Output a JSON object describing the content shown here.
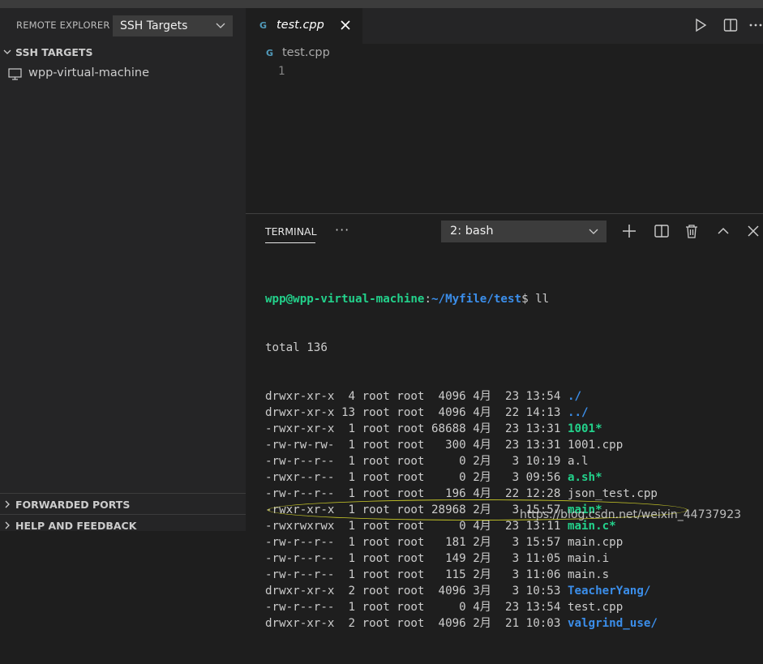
{
  "sidebar": {
    "header_label": "REMOTE EXPLORER",
    "selector_value": "SSH Targets",
    "sections": {
      "ssh_targets": "SSH TARGETS",
      "forwarded_ports": "FORWARDED PORTS",
      "help_feedback": "HELP AND FEEDBACK"
    },
    "targets": [
      "wpp-virtual-machine"
    ]
  },
  "editor": {
    "tab_label": "test.cpp",
    "breadcrumb": "test.cpp",
    "line_numbers": [
      "1"
    ],
    "file_icon": "cpp-file-icon"
  },
  "panel": {
    "tab_label": "TERMINAL",
    "more": "···",
    "terminal_select": "2: bash"
  },
  "terminal": {
    "prompt_user": "wpp@wpp-virtual-machine",
    "prompt_sep": ":",
    "prompt_path": "~/Myfile/test",
    "prompt_cmd": "$ ll",
    "total": "total 136",
    "rows": [
      {
        "meta": "drwxr-xr-x  4 root root  4096 4月  23 13:54 ",
        "name": "./",
        "kind": "dir"
      },
      {
        "meta": "drwxr-xr-x 13 root root  4096 4月  22 14:13 ",
        "name": "../",
        "kind": "dir"
      },
      {
        "meta": "-rwxr-xr-x  1 root root 68688 4月  23 13:31 ",
        "name": "1001*",
        "kind": "exe"
      },
      {
        "meta": "-rw-rw-rw-  1 root root   300 4月  23 13:31 ",
        "name": "1001.cpp",
        "kind": "file"
      },
      {
        "meta": "-rw-r--r--  1 root root     0 2月   3 10:19 ",
        "name": "a.l",
        "kind": "file"
      },
      {
        "meta": "-rwxr--r--  1 root root     0 2月   3 09:56 ",
        "name": "a.sh*",
        "kind": "exe"
      },
      {
        "meta": "-rw-r--r--  1 root root   196 4月  22 12:28 ",
        "name": "json_test.cpp",
        "kind": "file"
      },
      {
        "meta": "-rwxr-xr-x  1 root root 28968 2月   3 15:57 ",
        "name": "main*",
        "kind": "exe"
      },
      {
        "meta": "-rwxrwxrwx  1 root root     0 4月  23 13:11 ",
        "name": "main.c*",
        "kind": "exe"
      },
      {
        "meta": "-rw-r--r--  1 root root   181 2月   3 15:57 ",
        "name": "main.cpp",
        "kind": "file"
      },
      {
        "meta": "-rw-r--r--  1 root root   149 2月   3 11:05 ",
        "name": "main.i",
        "kind": "file"
      },
      {
        "meta": "-rw-r--r--  1 root root   115 2月   3 11:06 ",
        "name": "main.s",
        "kind": "file"
      },
      {
        "meta": "drwxr-xr-x  2 root root  4096 3月   3 10:53 ",
        "name": "TeacherYang/",
        "kind": "dir"
      },
      {
        "meta": "-rw-r--r--  1 root root     0 4月  23 13:54 ",
        "name": "test.cpp",
        "kind": "file"
      },
      {
        "meta": "drwxr-xr-x  2 root root  4096 2月  21 10:03 ",
        "name": "valgrind_use/",
        "kind": "dir"
      }
    ]
  },
  "watermark": "https://blog.csdn.net/weixin_44737923",
  "colors": {
    "accent_green": "#23d18b",
    "accent_blue": "#3b8eea",
    "highlight_ellipse": "#c8c828"
  },
  "icons": [
    "monitor-icon",
    "chevron-down-icon",
    "chevron-right-icon",
    "close-icon",
    "run-icon",
    "split-editor-icon",
    "more-icon",
    "plus-icon",
    "trash-icon",
    "chevron-up-icon"
  ]
}
